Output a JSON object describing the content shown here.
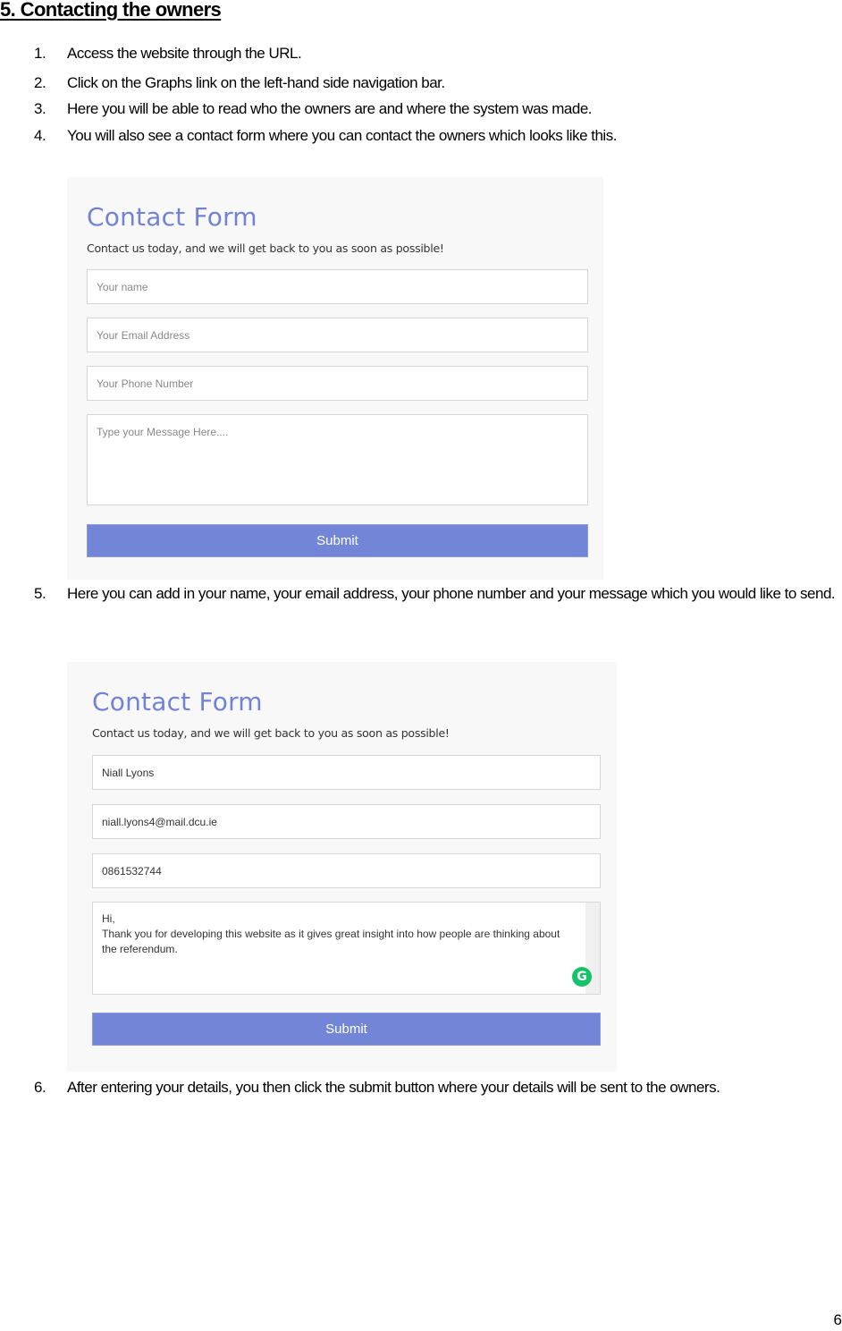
{
  "document": {
    "heading": "5. Contacting the owners",
    "page_number": "6",
    "steps": [
      {
        "num": "1.",
        "text": "Access the website through the URL."
      },
      {
        "num": "2.",
        "text": "Click on the Graphs link on the left-hand side navigation bar."
      },
      {
        "num": "3.",
        "text": "Here you will be able to read who the owners are and where the system was made."
      },
      {
        "num": "4.",
        "text": "You will also see a contact form where you can contact the owners which looks like this."
      },
      {
        "num": "5.",
        "text": "Here you can add in your name, your email address, your phone number and your message which you would like to send."
      },
      {
        "num": "6.",
        "text": "After entering your details, you then click the submit button where your details will be sent to the owners."
      }
    ]
  },
  "contact_form_empty": {
    "title": "Contact Form",
    "subtitle": "Contact us today, and we will get back to you as soon as possible!",
    "name_placeholder": "Your name",
    "email_placeholder": "Your Email Address",
    "phone_placeholder": "Your Phone Number",
    "message_placeholder": "Type your Message Here....",
    "submit_label": "Submit"
  },
  "contact_form_filled": {
    "title": "Contact Form",
    "subtitle": "Contact us today, and we will get back to you as soon as possible!",
    "name_value": "Niall Lyons",
    "email_value": "niall.lyons4@mail.dcu.ie",
    "phone_value": "0861532744",
    "message_line1": "Hi,",
    "message_line2": "Thank you for developing this website as it gives great insight into how people are thinking about",
    "message_line3": "the referendum.",
    "grammarly_glyph": "G",
    "submit_label": "Submit"
  },
  "colors": {
    "accent": "#7385d6",
    "title": "#7282d6",
    "grammarly": "#15c26b"
  }
}
